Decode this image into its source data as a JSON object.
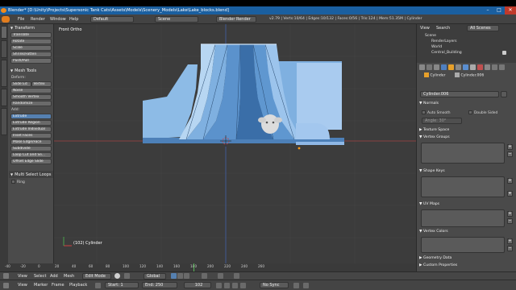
{
  "titlebar": {
    "title": "Blender* [D:\\Unity\\Projects\\Supersonic Tank Cats\\Assets\\Models\\Scenery_Models\\Lake\\Lake_blocks.blend]",
    "min": "–",
    "max": "□",
    "close": "✕"
  },
  "infobar": {
    "menus": [
      "File",
      "Render",
      "Window",
      "Help"
    ],
    "layout": "Default",
    "scene": "Scene",
    "engine": "Blender Render",
    "stats": "v2.79 | Verts:10/64 | Edges:10/132 | Faces:0/56 | Tris:124 | Mem:51.35M | Cylinder"
  },
  "tools": {
    "tabs": [
      "Tools",
      "Create",
      "Shading / UVs",
      "Options",
      "Grease Pencil"
    ],
    "transform_header": "Transform",
    "transform": [
      "Translate",
      "Rotate",
      "Scale",
      "Shrink/Fatten",
      "Push/Pull"
    ],
    "mesh_tools_header": "Mesh Tools",
    "deform_label": "Deform:",
    "slide_edge": "Slide Ed",
    "vertex": "Vertex",
    "deform": [
      "Noise",
      "Smooth Vertex",
      "Randomize"
    ],
    "add_label": "Add:",
    "extrude": "Extrude",
    "add": [
      "Extrude Region",
      "Extrude Individual",
      "Inset Faces",
      "Make Edge/Face",
      "Subdivide",
      "Loop Cut and Sli...",
      "Offset Edge Slide"
    ],
    "last_op_header": "Multi Select Loops",
    "last_op_option": "Ring"
  },
  "viewport": {
    "label": "Front Ortho",
    "object_label": "(102) Cylinder"
  },
  "viewport_header": {
    "view": "View",
    "select": "Select",
    "add": "Add",
    "mesh": "Mesh",
    "mode": "Edit Mode",
    "pivot": "Global"
  },
  "timeline": {
    "ruler": [
      "-40",
      "-20",
      "0",
      "20",
      "40",
      "60",
      "80",
      "100",
      "120",
      "140",
      "160",
      "180",
      "200",
      "220",
      "240",
      "260"
    ],
    "menus": [
      "View",
      "Marker",
      "Frame",
      "Playback"
    ],
    "start_label": "Start:",
    "start": "1",
    "end_label": "End:",
    "end": "250",
    "current": "102",
    "sync": "No Sync"
  },
  "outliner": {
    "view": "View",
    "search": "Search",
    "filter": "All Scenes",
    "rows": [
      "Scene",
      "RenderLayers",
      "World",
      "Central_Building"
    ]
  },
  "properties": {
    "object_name": "Cylinder",
    "mesh_name": "Cylinder.006",
    "datablock": "Cylinder.006",
    "normals_header": "Normals",
    "auto_smooth": "Auto Smooth",
    "double_sided": "Double Sided",
    "angle": "Angle:",
    "angle_val": "30°",
    "texture_space": "Texture Space",
    "vertex_groups": "Vertex Groups",
    "shape_keys": "Shape Keys",
    "uv_maps": "UV Maps",
    "vertex_colors": "Vertex Colors",
    "geometry_data": "Geometry Data",
    "custom_properties": "Custom Properties"
  },
  "colors": {
    "titlebar": "#1a5fa0",
    "mesh_light": "#b7d6f2",
    "mesh_mid": "#7fb0e0",
    "mesh_dark": "#3a6ea8",
    "selected_vertex": "#ff9b1a"
  }
}
